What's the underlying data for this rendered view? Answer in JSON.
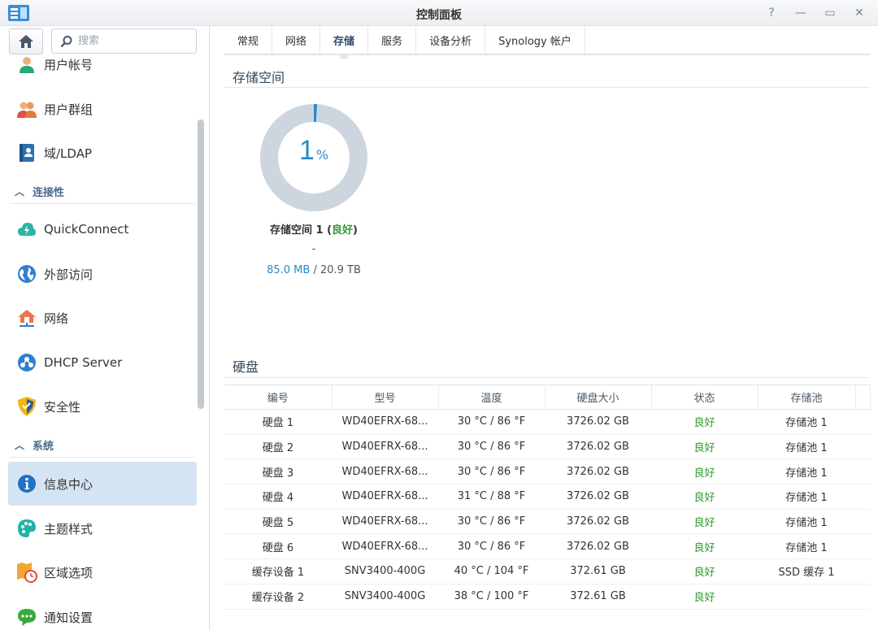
{
  "window": {
    "title": "控制面板"
  },
  "sidebar": {
    "search_placeholder": "搜索",
    "items": [
      {
        "label": "用户帐号",
        "icon": "user-icon"
      },
      {
        "label": "用户群组",
        "icon": "group-icon"
      },
      {
        "label": "域/LDAP",
        "icon": "directory-icon"
      }
    ],
    "section_connectivity": "连接性",
    "connectivity_items": [
      {
        "label": "QuickConnect",
        "icon": "quickconnect-icon"
      },
      {
        "label": "外部访问",
        "icon": "globe-icon"
      },
      {
        "label": "网络",
        "icon": "network-house-icon"
      },
      {
        "label": "DHCP Server",
        "icon": "dhcp-icon"
      },
      {
        "label": "安全性",
        "icon": "shield-icon"
      }
    ],
    "section_system": "系统",
    "system_items": [
      {
        "label": "信息中心",
        "icon": "info-icon",
        "active": true
      },
      {
        "label": "主题样式",
        "icon": "palette-icon"
      },
      {
        "label": "区域选项",
        "icon": "regional-clock-icon"
      },
      {
        "label": "通知设置",
        "icon": "chat-notification-icon"
      }
    ]
  },
  "tabs": [
    "常规",
    "网络",
    "存储",
    "服务",
    "设备分析",
    "Synology 帐户"
  ],
  "active_tab": "存储",
  "storage": {
    "title": "存储空间",
    "percent": "1",
    "percent_sign": "%",
    "volume_name": "存储空间 1 (",
    "volume_status": "良好",
    "volume_close": ")",
    "dash": "-",
    "used": "85.0 MB",
    "total": " / 20.9 TB"
  },
  "disks": {
    "title": "硬盘",
    "headers": [
      "编号",
      "型号",
      "温度",
      "硬盘大小",
      "状态",
      "存储池"
    ],
    "rows": [
      [
        "硬盘 1",
        "WD40EFRX-68...",
        "30 °C / 86 °F",
        "3726.02 GB",
        "良好",
        "存储池 1"
      ],
      [
        "硬盘 2",
        "WD40EFRX-68...",
        "30 °C / 86 °F",
        "3726.02 GB",
        "良好",
        "存储池 1"
      ],
      [
        "硬盘 3",
        "WD40EFRX-68...",
        "30 °C / 86 °F",
        "3726.02 GB",
        "良好",
        "存储池 1"
      ],
      [
        "硬盘 4",
        "WD40EFRX-68...",
        "31 °C / 88 °F",
        "3726.02 GB",
        "良好",
        "存储池 1"
      ],
      [
        "硬盘 5",
        "WD40EFRX-68...",
        "30 °C / 86 °F",
        "3726.02 GB",
        "良好",
        "存储池 1"
      ],
      [
        "硬盘 6",
        "WD40EFRX-68...",
        "30 °C / 86 °F",
        "3726.02 GB",
        "良好",
        "存储池 1"
      ],
      [
        "缓存设备 1",
        "SNV3400-400G",
        "40 °C / 104 °F",
        "372.61 GB",
        "良好",
        "SSD 缓存 1"
      ],
      [
        "缓存设备 2",
        "SNV3400-400G",
        "38 °C / 100 °F",
        "372.61 GB",
        "良好",
        ""
      ]
    ]
  },
  "colors": {
    "accent": "#2b88c9",
    "good": "#2e9b2e",
    "active_bg": "#d5e4f3"
  }
}
